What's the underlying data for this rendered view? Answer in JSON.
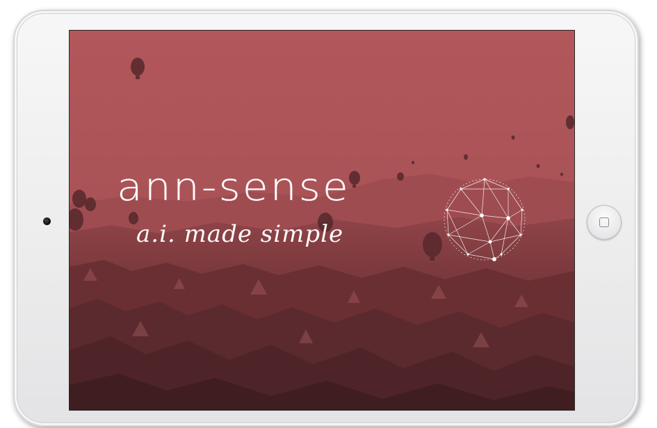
{
  "app": {
    "brand_name": "ann-sense",
    "tagline": "a.i. made simple"
  },
  "device": {
    "type": "tablet",
    "home_button_icon": "home-square-icon",
    "camera_icon": "front-camera-icon"
  },
  "colors": {
    "screen_tint": "#a04a4e",
    "text": "#ffffff",
    "bezel": "#efeff0"
  },
  "icons": {
    "logo_graphic": "network-sphere-icon"
  }
}
